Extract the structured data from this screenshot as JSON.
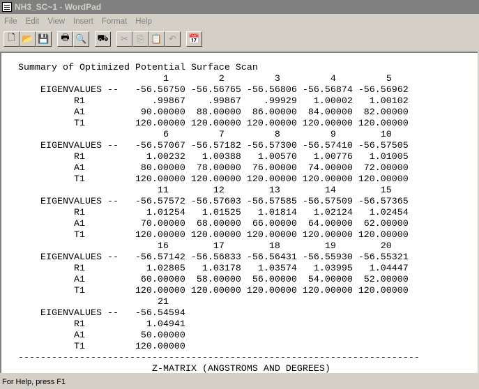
{
  "window": {
    "title": "NH3_SC~1 - WordPad"
  },
  "menu": [
    "File",
    "Edit",
    "View",
    "Insert",
    "Format",
    "Help"
  ],
  "toolbar": [
    {
      "name": "new-icon",
      "glyph": "🗋"
    },
    {
      "name": "open-icon",
      "glyph": "📂"
    },
    {
      "name": "save-icon",
      "glyph": "💾"
    },
    {
      "sep": true
    },
    {
      "name": "print-icon",
      "glyph": "🖶"
    },
    {
      "name": "print-preview-icon",
      "glyph": "🔍"
    },
    {
      "sep": true
    },
    {
      "name": "find-icon",
      "glyph": "⛟"
    },
    {
      "sep": true
    },
    {
      "name": "cut-icon",
      "glyph": "✂",
      "disabled": true
    },
    {
      "name": "copy-icon",
      "glyph": "⎘",
      "disabled": true
    },
    {
      "name": "paste-icon",
      "glyph": "📋"
    },
    {
      "name": "undo-icon",
      "glyph": "↶",
      "disabled": true
    },
    {
      "sep": true
    },
    {
      "name": "date-time-icon",
      "glyph": "📅"
    }
  ],
  "document": {
    "heading": "Summary of Optimized Potential Surface Scan",
    "eigen_label": "    EIGENVALUES --",
    "row_labels": [
      "          R1",
      "          A1",
      "          T1"
    ],
    "blocks": [
      {
        "idx": [
          "1",
          "2",
          "3",
          "4",
          "5"
        ],
        "eig": [
          "-56.56750",
          "-56.56765",
          "-56.56806",
          "-56.56874",
          "-56.56962"
        ],
        "R1": [
          ".99867",
          ".99867",
          ".99929",
          "1.00002",
          "1.00102"
        ],
        "A1": [
          "90.00000",
          "88.00000",
          "86.00000",
          "84.00000",
          "82.00000"
        ],
        "T1": [
          "120.00000",
          "120.00000",
          "120.00000",
          "120.00000",
          "120.00000"
        ]
      },
      {
        "idx": [
          "6",
          "7",
          "8",
          "9",
          "10"
        ],
        "eig": [
          "-56.57067",
          "-56.57182",
          "-56.57300",
          "-56.57410",
          "-56.57505"
        ],
        "R1": [
          "1.00232",
          "1.00388",
          "1.00570",
          "1.00776",
          "1.01005"
        ],
        "A1": [
          "80.00000",
          "78.00000",
          "76.00000",
          "74.00000",
          "72.00000"
        ],
        "T1": [
          "120.00000",
          "120.00000",
          "120.00000",
          "120.00000",
          "120.00000"
        ]
      },
      {
        "idx": [
          "11",
          "12",
          "13",
          "14",
          "15"
        ],
        "eig": [
          "-56.57572",
          "-56.57603",
          "-56.57585",
          "-56.57509",
          "-56.57365"
        ],
        "R1": [
          "1.01254",
          "1.01525",
          "1.01814",
          "1.02124",
          "1.02454"
        ],
        "A1": [
          "70.00000",
          "68.00000",
          "66.00000",
          "64.00000",
          "62.00000"
        ],
        "T1": [
          "120.00000",
          "120.00000",
          "120.00000",
          "120.00000",
          "120.00000"
        ]
      },
      {
        "idx": [
          "16",
          "17",
          "18",
          "19",
          "20"
        ],
        "eig": [
          "-56.57142",
          "-56.56833",
          "-56.56431",
          "-56.55930",
          "-56.55321"
        ],
        "R1": [
          "1.02805",
          "1.03178",
          "1.03574",
          "1.03995",
          "1.04447"
        ],
        "A1": [
          "60.00000",
          "58.00000",
          "56.00000",
          "54.00000",
          "52.00000"
        ],
        "T1": [
          "120.00000",
          "120.00000",
          "120.00000",
          "120.00000",
          "120.00000"
        ]
      },
      {
        "idx": [
          "21"
        ],
        "eig": [
          "-56.54594"
        ],
        "R1": [
          "1.04941"
        ],
        "A1": [
          "50.00000"
        ],
        "T1": [
          "120.00000"
        ]
      }
    ],
    "divider": "------------------------------------------------------------------------",
    "zmatrix_heading": "                        Z-MATRIX (ANGSTROMS AND DEGREES)"
  },
  "status": {
    "text": "For Help, press F1"
  }
}
